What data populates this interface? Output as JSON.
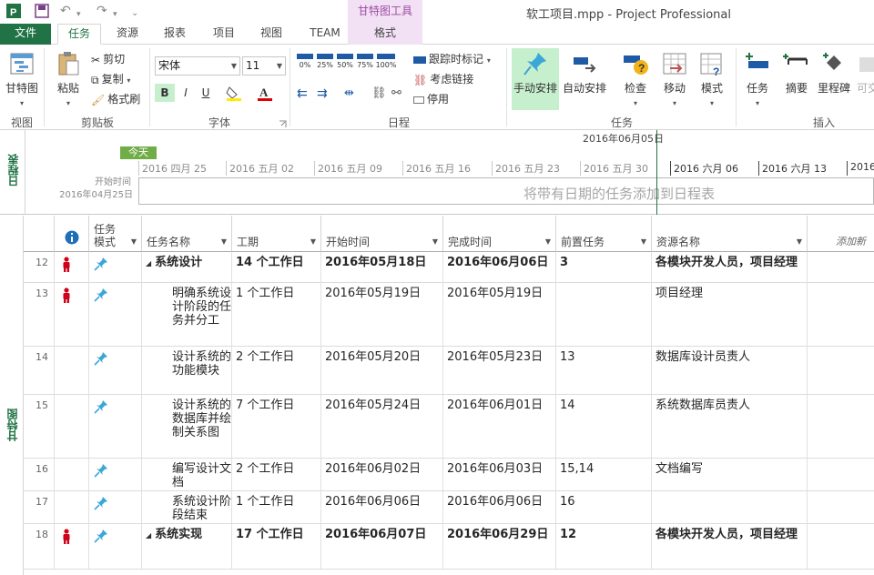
{
  "app": {
    "title": "软工项目.mpp - Project Professional",
    "context_tools_label": "甘特图工具"
  },
  "tabs": [
    {
      "label": "文件"
    },
    {
      "label": "任务"
    },
    {
      "label": "资源"
    },
    {
      "label": "报表"
    },
    {
      "label": "项目"
    },
    {
      "label": "视图"
    },
    {
      "label": "TEAM"
    },
    {
      "label": "格式"
    }
  ],
  "ribbon": {
    "view": {
      "gantt_label": "甘特图",
      "group": "视图"
    },
    "clipboard": {
      "paste": "粘贴",
      "cut": "剪切",
      "copy": "复制",
      "format_painter": "格式刷",
      "group": "剪贴板"
    },
    "font": {
      "name": "宋体",
      "size": "11",
      "bold": "B",
      "italic": "I",
      "underline": "U",
      "group": "字体"
    },
    "schedule": {
      "pct": [
        "0%",
        "25%",
        "50%",
        "75%",
        "100%"
      ],
      "mark_on_track": "跟踪时标记",
      "respect_links": "考虑链接",
      "inactivate": "停用",
      "group": "日程"
    },
    "tasks": {
      "manual": "手动安排",
      "auto": "自动安排",
      "inspect": "检查",
      "move": "移动",
      "mode": "模式",
      "group": "任务"
    },
    "insert": {
      "task": "任务",
      "summary": "摘要",
      "milestone": "里程碑",
      "deliverable": "可交",
      "group": "插入"
    }
  },
  "timeline": {
    "side_label": "日程表",
    "today": "今天",
    "today_date": "2016年06月05日",
    "start_label": "开始时间",
    "start_date": "2016年04月25日",
    "dates": [
      "2016 四月 25",
      "2016 五月 02",
      "2016 五月 09",
      "2016 五月 16",
      "2016 五月 23",
      "2016 五月 30",
      "2016 六月 06",
      "2016 六月 13",
      "2016"
    ],
    "placeholder": "将带有日期的任务添加到日程表"
  },
  "grid": {
    "side_label": "甘特图",
    "headers": {
      "mode": "任务\n模式",
      "name": "任务名称",
      "duration": "工期",
      "start": "开始时间",
      "finish": "完成时间",
      "predecessors": "前置任务",
      "resources": "资源名称",
      "add_column": "添加新"
    },
    "rows": [
      {
        "id": "12",
        "indicator": "red-person",
        "name": "系统设计",
        "summary": true,
        "duration": "14 个工作日",
        "start": "2016年05月18日",
        "finish": "2016年06月06日",
        "pred": "3",
        "res": "各模块开发人员，项目经理"
      },
      {
        "id": "13",
        "indicator": "red-person",
        "name": "明确系统设计阶段的任务并分工",
        "summary": false,
        "duration": "1 个工作日",
        "start": "2016年05月19日",
        "finish": "2016年05月19日",
        "pred": "",
        "res": "项目经理"
      },
      {
        "id": "14",
        "indicator": "",
        "name": "设计系统的功能模块",
        "summary": false,
        "duration": "2 个工作日",
        "start": "2016年05月20日",
        "finish": "2016年05月23日",
        "pred": "13",
        "res": "数据库设计员责人"
      },
      {
        "id": "15",
        "indicator": "",
        "name": "设计系统的数据库并绘制关系图",
        "summary": false,
        "duration": "7 个工作日",
        "start": "2016年05月24日",
        "finish": "2016年06月01日",
        "pred": "14",
        "res": "系统数据库员责人"
      },
      {
        "id": "16",
        "indicator": "",
        "name": "编写设计文档",
        "summary": false,
        "duration": "2 个工作日",
        "start": "2016年06月02日",
        "finish": "2016年06月03日",
        "pred": "15,14",
        "res": "文档编写"
      },
      {
        "id": "17",
        "indicator": "",
        "name": "系统设计阶段结束",
        "summary": false,
        "duration": "1 个工作日",
        "start": "2016年06月06日",
        "finish": "2016年06月06日",
        "pred": "16",
        "res": ""
      },
      {
        "id": "18",
        "indicator": "red-person",
        "name": "系统实现",
        "summary": true,
        "duration": "17 个工作日",
        "start": "2016年06月07日",
        "finish": "2016年06月29日",
        "pred": "12",
        "res": "各模块开发人员，项目经理"
      }
    ]
  },
  "colors": {
    "accent_green": "#217346",
    "context_purple": "#9b4aa3",
    "pin_blue": "#3aa7d6",
    "indicator_red": "#d0021b"
  }
}
